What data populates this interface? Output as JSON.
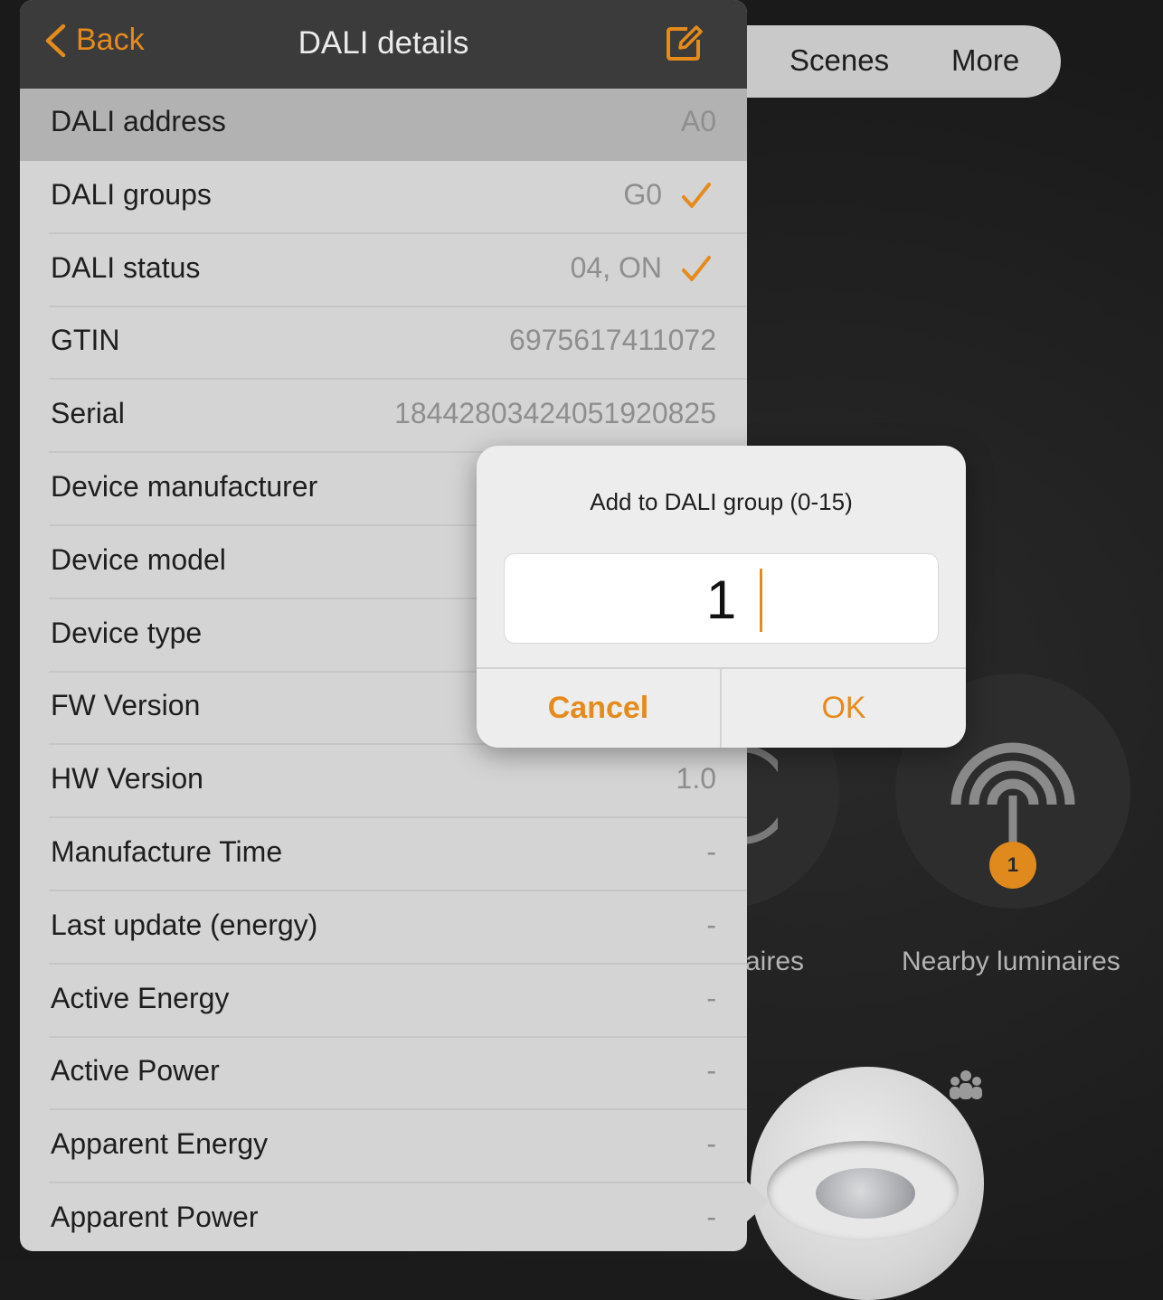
{
  "nav": {
    "back_label": "Back",
    "title": "DALI details",
    "edit_icon": "compose-icon"
  },
  "rows": [
    {
      "label": "DALI address",
      "value": "A0",
      "checked": false,
      "highlighted": true
    },
    {
      "label": "DALI groups",
      "value": "G0",
      "checked": true
    },
    {
      "label": "DALI status",
      "value": "04, ON",
      "checked": true
    },
    {
      "label": "GTIN",
      "value": "6975617411072"
    },
    {
      "label": "Serial",
      "value": "18442803424051920825"
    },
    {
      "label": "Device manufacturer",
      "value": ""
    },
    {
      "label": "Device model",
      "value": ""
    },
    {
      "label": "Device type",
      "value": ""
    },
    {
      "label": "FW Version",
      "value": ""
    },
    {
      "label": "HW Version",
      "value": "1.0"
    },
    {
      "label": "Manufacture Time",
      "value": "-"
    },
    {
      "label": "Last update (energy)",
      "value": "-"
    },
    {
      "label": "Active Energy",
      "value": "-"
    },
    {
      "label": "Active Power",
      "value": "-"
    },
    {
      "label": "Apparent Energy",
      "value": "-"
    },
    {
      "label": "Apparent Power",
      "value": "-"
    }
  ],
  "dialog": {
    "title": "Add to DALI group (0-15)",
    "input_value": "1",
    "cancel_label": "Cancel",
    "ok_label": "OK"
  },
  "background": {
    "tabs": [
      "Scenes",
      "More"
    ],
    "partial_label": "aires",
    "nearby_label": "Nearby luminaires",
    "nearby_count": "1"
  },
  "colors": {
    "accent": "#e58b1c",
    "panel": "#d4d4d4",
    "navbar": "#3b3b3b",
    "background": "#1b1b1b"
  }
}
